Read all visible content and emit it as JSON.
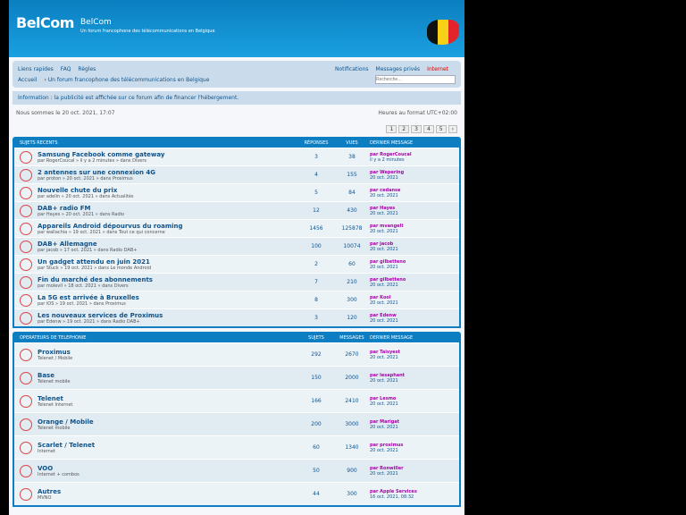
{
  "header": {
    "logo": "BelCom",
    "site_name": "BelCom",
    "description": "Un forum francophone des télécommunications en Belgique"
  },
  "nav": {
    "left": [
      "Liens rapides",
      "FAQ",
      "Règles"
    ],
    "right": [
      "Notifications",
      "Messages privés",
      "Internet"
    ],
    "breadcrumb": [
      "Accueil",
      "Un forum francophone des télécommunications en Belgique"
    ],
    "search_placeholder": "Recherche…"
  },
  "notice": "Information : la publicité est affichée sur ce forum afin de financer l'hébergement.",
  "meta": {
    "left": "Nous sommes le 20 oct. 2021, 17:07",
    "right": "Heures au format UTC+02:00"
  },
  "pager": [
    "1",
    "2",
    "3",
    "4",
    "5",
    "›"
  ],
  "topics_header": {
    "title": "Sujets récents",
    "c2": "Réponses",
    "c3": "Vues",
    "c4": "Dernier message"
  },
  "topics": [
    {
      "title": "Samsung Facebook comme gateway",
      "sub": "par RogerCoucal » il y a 2 minutes » dans Divers",
      "r": "3",
      "v": "38",
      "last": "par RogerCoucal",
      "lastdate": "il y a 2 minutes"
    },
    {
      "title": "2 antennes sur une connexion 4G",
      "sub": "par proton » 20 oct. 2021 » dans Proximus",
      "r": "4",
      "v": "155",
      "last": "par Wepering",
      "lastdate": "20 oct. 2021"
    },
    {
      "title": "Nouvelle chute du prix",
      "sub": "par adelin » 20 oct. 2021 » dans Actualités",
      "r": "5",
      "v": "84",
      "last": "par cedanse",
      "lastdate": "20 oct. 2021"
    },
    {
      "title": "DAB+ radio FM",
      "sub": "par Hayes » 20 oct. 2021 » dans Radio",
      "r": "12",
      "v": "430",
      "last": "par Hayes",
      "lastdate": "20 oct. 2021"
    },
    {
      "title": "Appareils Android dépourvus du roaming",
      "sub": "par wallachia » 19 oct. 2021 » dans Tout ce qui concerne",
      "r": "1456",
      "v": "125878",
      "last": "par mvangelt",
      "lastdate": "20 oct. 2021"
    },
    {
      "title": "DAB+ Allemagne",
      "sub": "par jacob » 17 oct. 2021 » dans Radio DAB+",
      "r": "100",
      "v": "10074",
      "last": "par jacob",
      "lastdate": "20 oct. 2021"
    },
    {
      "title": "Un gadget attendu en juin 2021",
      "sub": "par Stuck » 19 oct. 2021 » dans Le monde Android",
      "r": "2",
      "v": "60",
      "last": "par gilbetteno",
      "lastdate": "20 oct. 2021"
    },
    {
      "title": "Fin du marché des abonnements",
      "sub": "par molevil » 18 oct. 2021 » dans Divers",
      "r": "7",
      "v": "210",
      "last": "par gilbetteno",
      "lastdate": "20 oct. 2021"
    },
    {
      "title": "La 5G est arrivée à Bruxelles",
      "sub": "par iOS » 19 oct. 2021 » dans Proximus",
      "r": "8",
      "v": "300",
      "last": "par Kool",
      "lastdate": "20 oct. 2021"
    },
    {
      "title": "Les nouveaux services de Proximus",
      "sub": "par Edenw » 19 oct. 2021 » dans Radio DAB+",
      "r": "3",
      "v": "120",
      "last": "par Edenw",
      "lastdate": "20 oct. 2021"
    }
  ],
  "forums_header": {
    "title": "Opérateurs de téléphonie",
    "c2": "Sujets",
    "c3": "Messages",
    "c4": "Dernier message"
  },
  "forums": [
    {
      "title": "Proximus",
      "sub": "Telenet / Mobile",
      "r": "292",
      "v": "2670",
      "last": "par Taisyest",
      "lastdate": "20 oct. 2021"
    },
    {
      "title": "Base",
      "sub": "Telenet mobile",
      "r": "150",
      "v": "2000",
      "last": "par lesaphant",
      "lastdate": "20 oct. 2021"
    },
    {
      "title": "Telenet",
      "sub": "Telenet Internet",
      "r": "166",
      "v": "2410",
      "last": "par Lesmo",
      "lastdate": "20 oct. 2021"
    },
    {
      "title": "Orange / Mobile",
      "sub": "Telenet mobile",
      "r": "200",
      "v": "3000",
      "last": "par Marigat",
      "lastdate": "20 oct. 2021"
    },
    {
      "title": "Scarlet / Telenet",
      "sub": "Internet",
      "r": "60",
      "v": "1340",
      "last": "par proximus",
      "lastdate": "20 oct. 2021"
    },
    {
      "title": "VOO",
      "sub": "Internet + combos",
      "r": "50",
      "v": "900",
      "last": "par Ronwiller",
      "lastdate": "20 oct. 2021"
    },
    {
      "title": "Autres",
      "sub": "MVNO",
      "r": "44",
      "v": "300",
      "last": "par Apple Services",
      "lastdate": "16 oct. 2021, 08:32"
    }
  ]
}
